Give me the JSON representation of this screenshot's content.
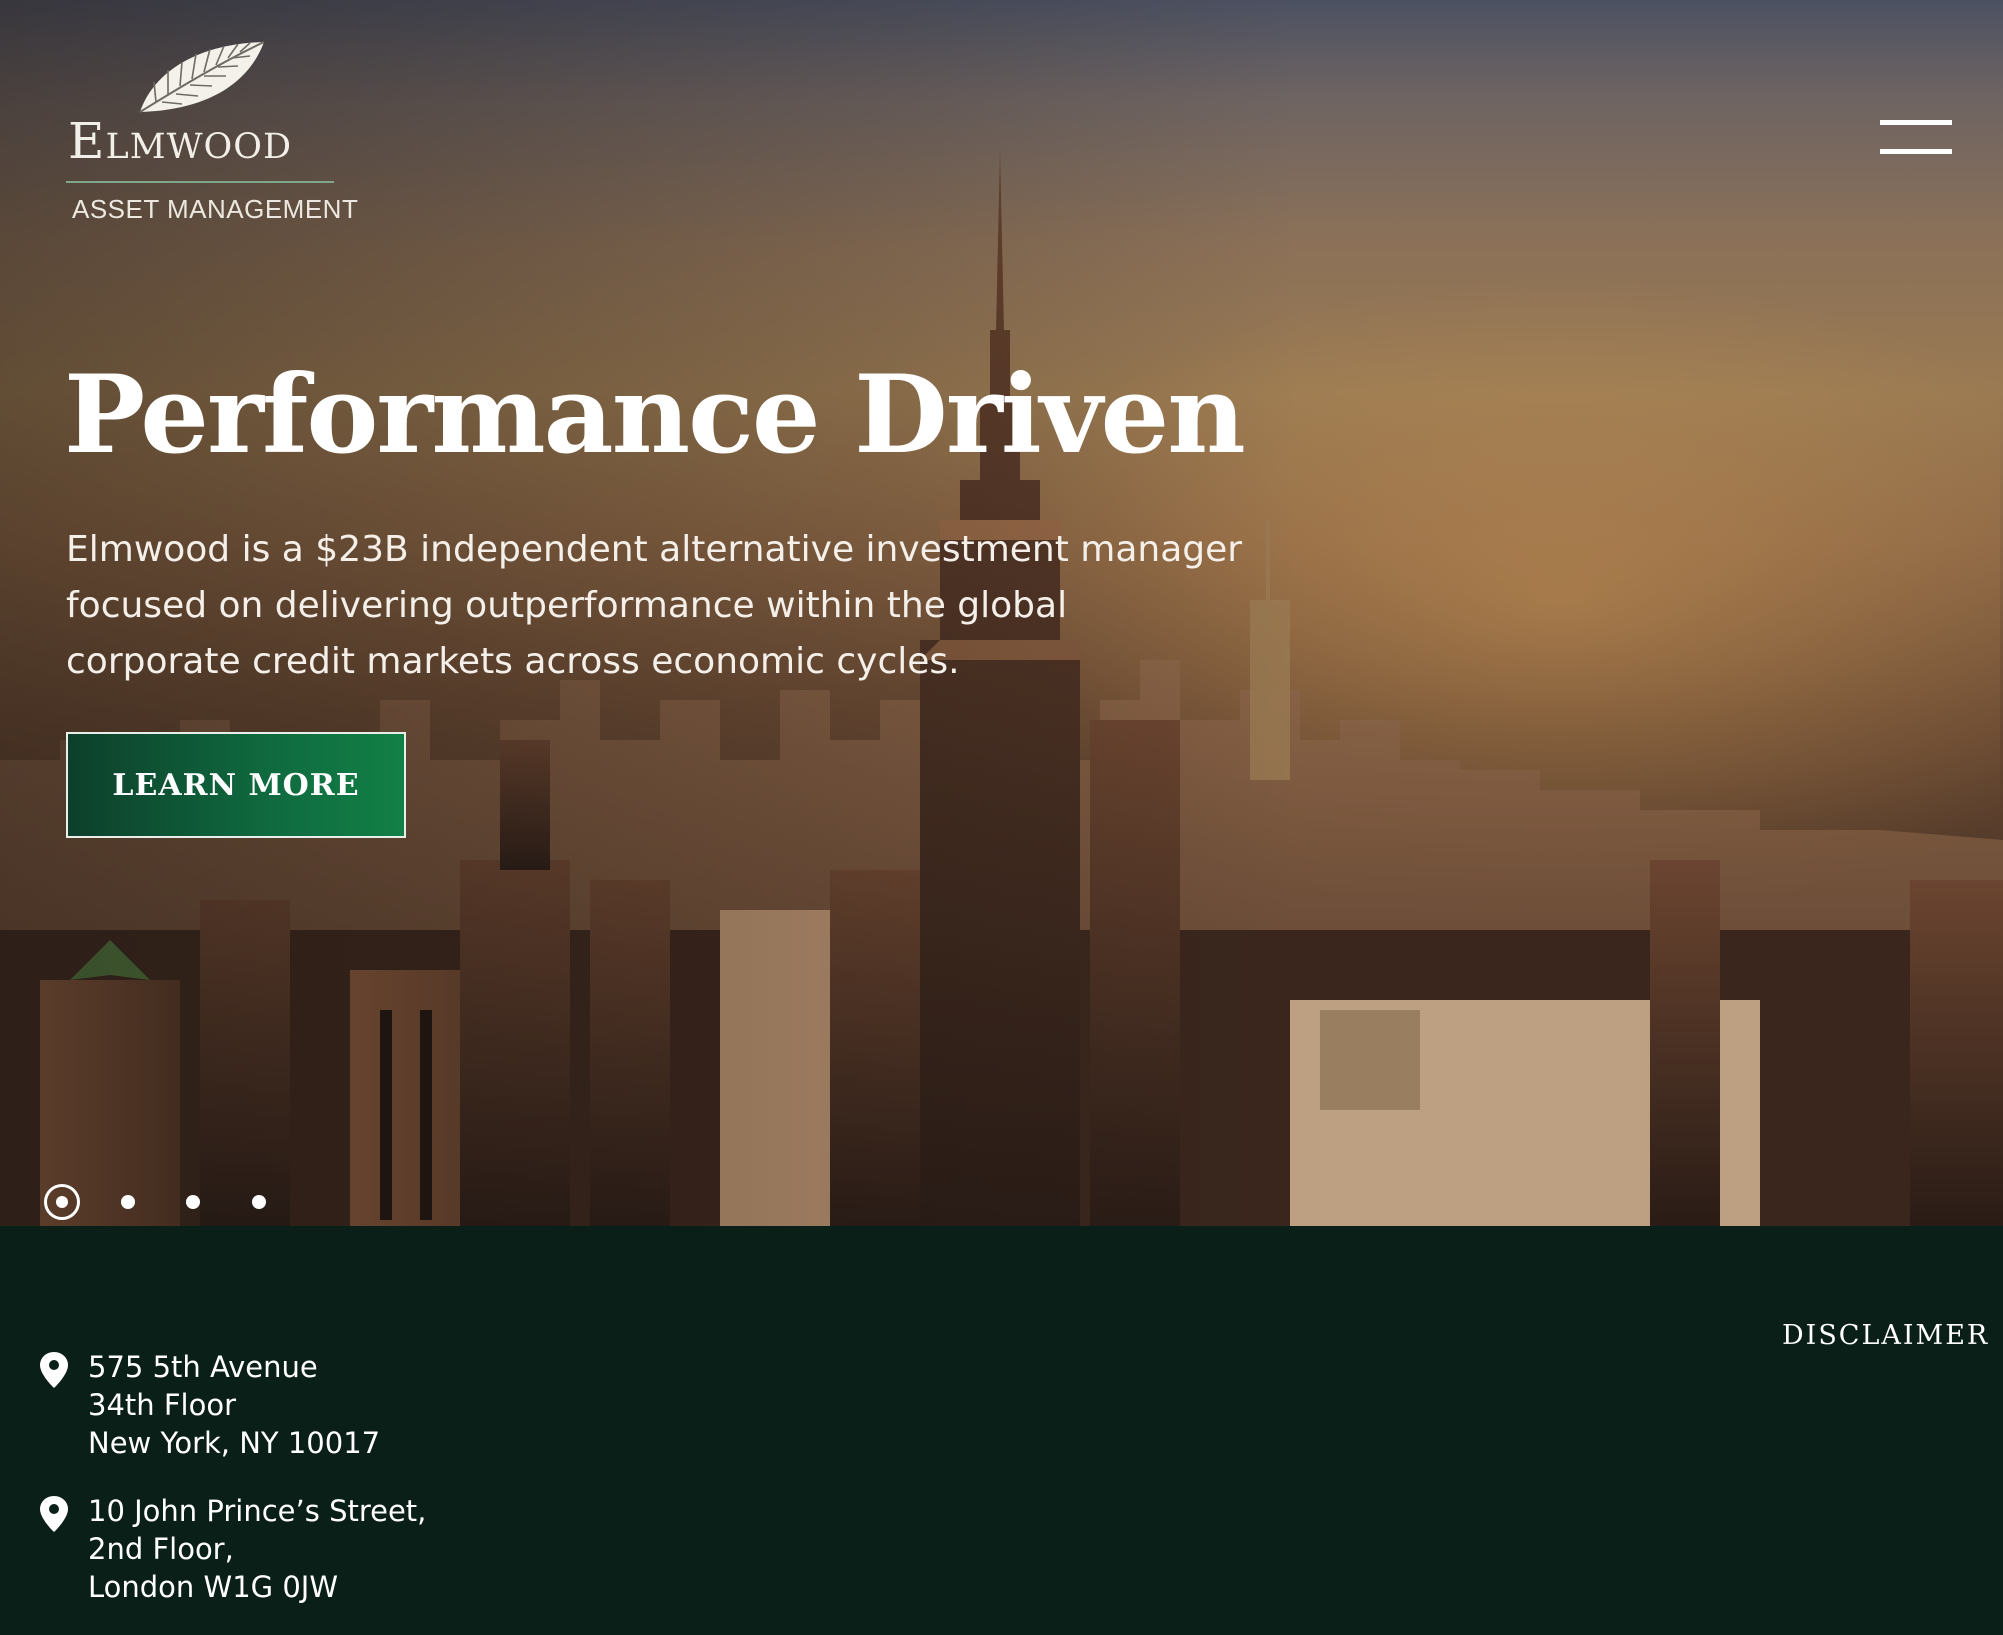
{
  "brand": {
    "name": "Elmwood",
    "tagline": "ASSET MANAGEMENT",
    "logo_icon": "leaf-icon"
  },
  "nav": {
    "menu_icon": "hamburger-menu-icon"
  },
  "hero": {
    "headline": "Performance Driven",
    "intro": "Elmwood is a $23B independent alternative investment manager focused on delivering outperformance within the global corporate credit markets across economic cycles.",
    "cta_label": "LEARN MORE",
    "slides": {
      "count": 4,
      "active_index": 0
    }
  },
  "footer": {
    "offices": [
      {
        "icon": "location-pin-icon",
        "lines": [
          "575 5th Avenue",
          "34th Floor",
          "New York, NY 10017"
        ]
      },
      {
        "icon": "location-pin-icon",
        "lines": [
          "10 John Prince’s Street,",
          "2nd Floor,",
          "London W1G 0JW"
        ]
      }
    ],
    "disclaimer_label": "DISCLAIMER"
  },
  "colors": {
    "footer_bg": "#0b1f19",
    "button_green": "#0f6a3f",
    "accent_rule": "#7fa58b"
  }
}
